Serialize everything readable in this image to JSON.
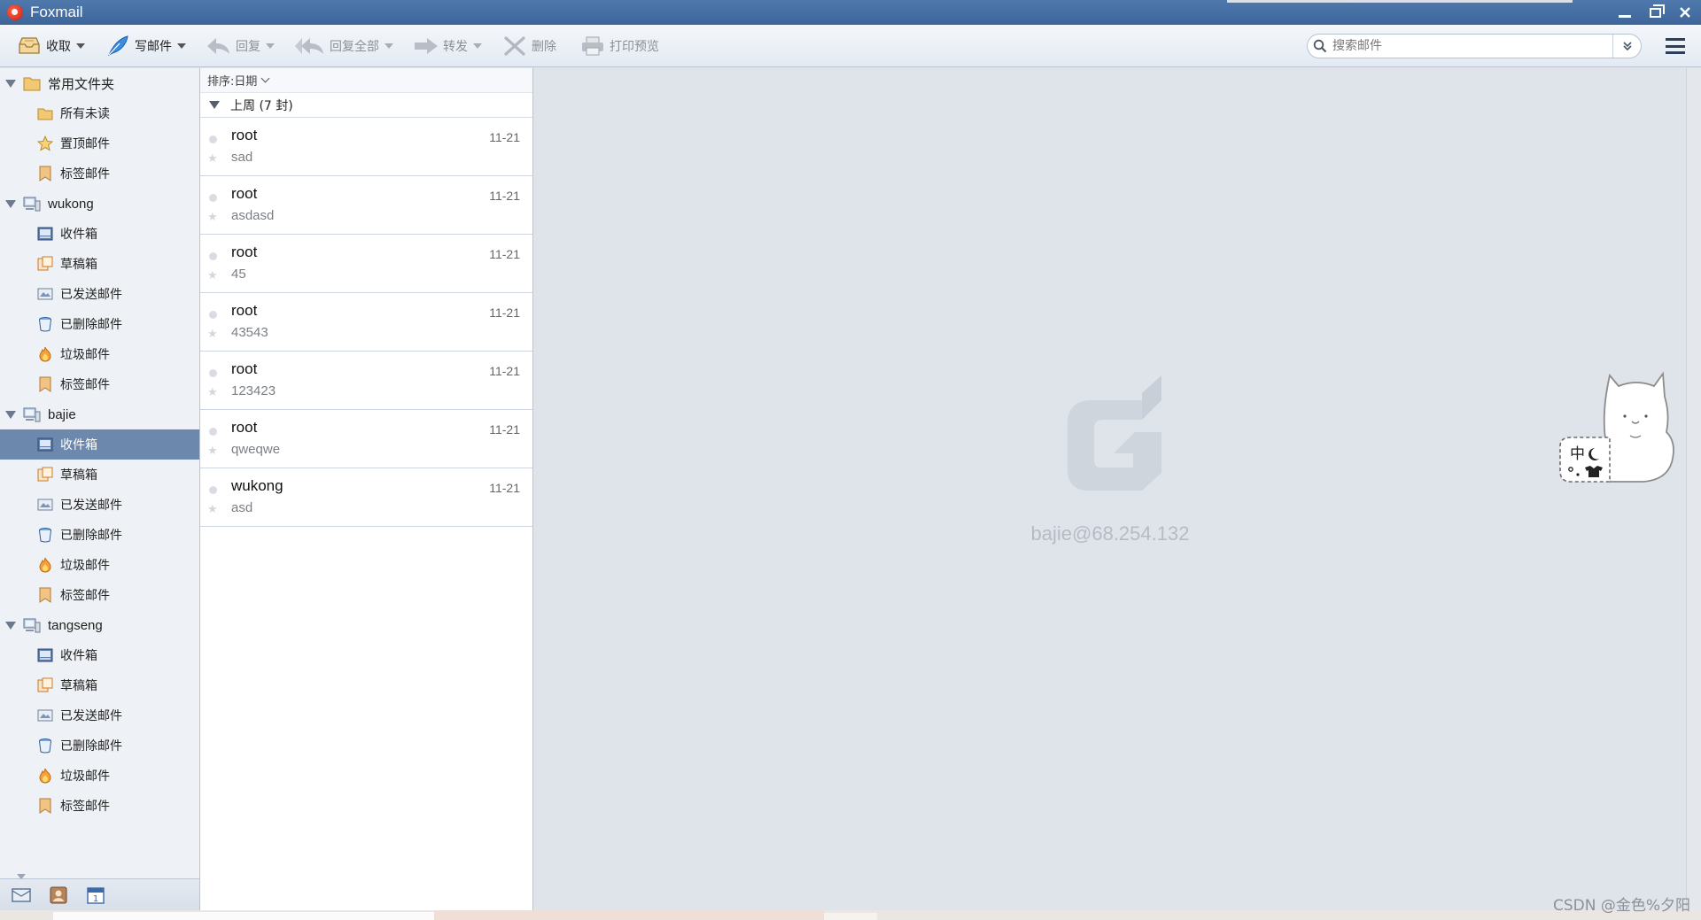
{
  "window": {
    "title": "Foxmail",
    "icon": "foxmail-logo-icon"
  },
  "toolbar": {
    "receive": {
      "label": "收取",
      "icon": "inbox-tray-icon"
    },
    "compose": {
      "label": "写邮件",
      "icon": "feather-pen-icon"
    },
    "reply": {
      "label": "回复",
      "icon": "reply-arrow-icon"
    },
    "reply_all": {
      "label": "回复全部",
      "icon": "reply-all-arrow-icon"
    },
    "forward": {
      "label": "转发",
      "icon": "forward-arrow-icon"
    },
    "delete": {
      "label": "删除",
      "icon": "delete-x-icon"
    },
    "print_preview": {
      "label": "打印预览",
      "icon": "printer-icon"
    },
    "search_placeholder": "搜索邮件"
  },
  "sidebar": {
    "common": {
      "label": "常用文件夹",
      "items": [
        {
          "label": "所有未读",
          "icon": "folder-icon"
        },
        {
          "label": "置顶邮件",
          "icon": "star-icon"
        },
        {
          "label": "标签邮件",
          "icon": "tag-icon"
        }
      ]
    },
    "accounts": [
      {
        "label": "wukong",
        "items": [
          {
            "label": "收件箱",
            "icon": "inbox-icon"
          },
          {
            "label": "草稿箱",
            "icon": "drafts-icon"
          },
          {
            "label": "已发送邮件",
            "icon": "sent-icon"
          },
          {
            "label": "已删除邮件",
            "icon": "trash-icon"
          },
          {
            "label": "垃圾邮件",
            "icon": "spam-fire-icon"
          },
          {
            "label": "标签邮件",
            "icon": "tag-icon"
          }
        ]
      },
      {
        "label": "bajie",
        "items": [
          {
            "label": "收件箱",
            "icon": "inbox-icon",
            "selected": true
          },
          {
            "label": "草稿箱",
            "icon": "drafts-icon"
          },
          {
            "label": "已发送邮件",
            "icon": "sent-icon"
          },
          {
            "label": "已删除邮件",
            "icon": "trash-icon"
          },
          {
            "label": "垃圾邮件",
            "icon": "spam-fire-icon"
          },
          {
            "label": "标签邮件",
            "icon": "tag-icon"
          }
        ]
      },
      {
        "label": "tangseng",
        "items": [
          {
            "label": "收件箱",
            "icon": "inbox-icon"
          },
          {
            "label": "草稿箱",
            "icon": "drafts-icon"
          },
          {
            "label": "已发送邮件",
            "icon": "sent-icon"
          },
          {
            "label": "已删除邮件",
            "icon": "trash-icon"
          },
          {
            "label": "垃圾邮件",
            "icon": "spam-fire-icon"
          },
          {
            "label": "标签邮件",
            "icon": "tag-icon"
          }
        ]
      }
    ],
    "bottom_icons": [
      "mail-view-icon",
      "contacts-icon",
      "calendar-icon"
    ]
  },
  "maillist": {
    "sort_label": "排序:日期",
    "group_label": "上周 (7 封)",
    "mails": [
      {
        "sender": "root",
        "subject": "sad",
        "date": "11-21"
      },
      {
        "sender": "root",
        "subject": "asdasd",
        "date": "11-21"
      },
      {
        "sender": "root",
        "subject": "45",
        "date": "11-21"
      },
      {
        "sender": "root",
        "subject": "43543",
        "date": "11-21"
      },
      {
        "sender": "root",
        "subject": "123423",
        "date": "11-21"
      },
      {
        "sender": "root",
        "subject": "qweqwe",
        "date": "11-21"
      },
      {
        "sender": "wukong",
        "subject": "asd",
        "date": "11-21"
      }
    ]
  },
  "reading": {
    "account_label": "bajie@68.254.132",
    "ime_text": "中"
  },
  "watermark": "CSDN @金色%夕阳",
  "colors": {
    "titlebar": "#4a72a6",
    "selected_row": "#6d88ad",
    "reading_bg": "#dfe4ea"
  }
}
